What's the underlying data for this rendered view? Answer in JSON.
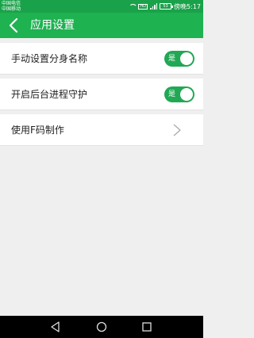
{
  "status_bar": {
    "carrier_1": "中国电信",
    "carrier_2": "中国移动",
    "network_tag": "HD",
    "battery": "53",
    "time": "傍晚5:17",
    "icons": [
      "wifi-icon",
      "signal-icon",
      "battery-icon"
    ]
  },
  "app_bar": {
    "title": "应用设置",
    "back_icon": "chevron-left-icon",
    "color": "#1eb251"
  },
  "settings": [
    {
      "label": "手动设置分身名称",
      "control": "toggle",
      "value": "是",
      "on": true
    },
    {
      "label": "开启后台进程守护",
      "control": "toggle",
      "value": "是",
      "on": true
    },
    {
      "label": "使用F码制作",
      "control": "chevron",
      "icon": "chevron-right-icon"
    }
  ],
  "nav_bar": {
    "icons": [
      "back-triangle-icon",
      "home-circle-icon",
      "recents-square-icon"
    ]
  }
}
